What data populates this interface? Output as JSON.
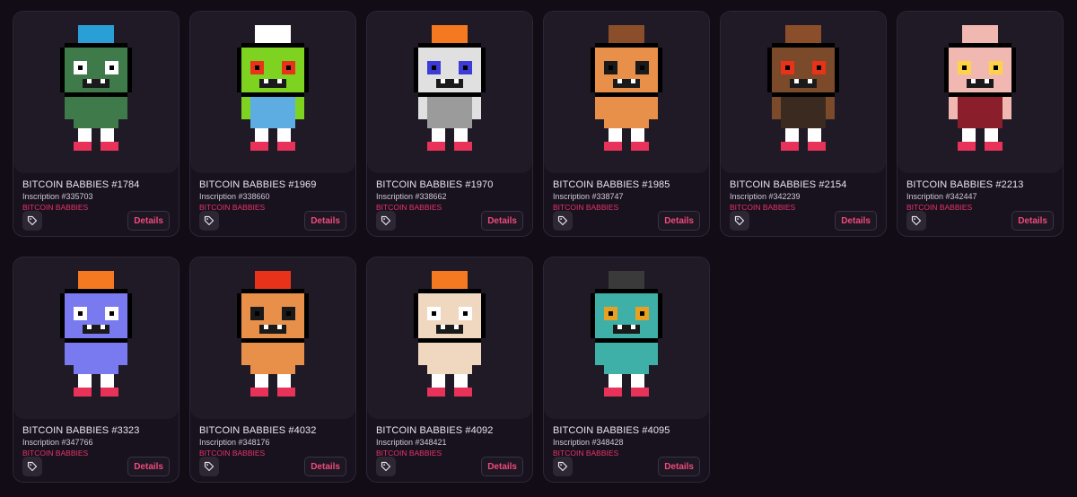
{
  "collection_label": "BITCOIN BABBIES",
  "details_label": "Details",
  "items": [
    {
      "name": "BITCOIN BABBIES #1784",
      "inscription": "Inscription #335703",
      "skin": "#3f7a4a",
      "hat": "#2a9fd6",
      "eyes": "#ffffff",
      "top": "#3f7a4a"
    },
    {
      "name": "BITCOIN BABBIES #1969",
      "inscription": "Inscription #338660",
      "skin": "#7ed321",
      "hat": "#ffffff",
      "eyes": "#e8321a",
      "top": "#5dade2"
    },
    {
      "name": "BITCOIN BABBIES #1970",
      "inscription": "Inscription #338662",
      "skin": "#e0e0e0",
      "hat": "#f47920",
      "eyes": "#3b3bd6",
      "top": "#9b9b9b"
    },
    {
      "name": "BITCOIN BABBIES #1985",
      "inscription": "Inscription #338747",
      "skin": "#e8904a",
      "hat": "#8a4e2a",
      "eyes": "#1a1a1a",
      "top": "#e8904a"
    },
    {
      "name": "BITCOIN BABBIES #2154",
      "inscription": "Inscription #342239",
      "skin": "#7a4a2a",
      "hat": "#8a4e2a",
      "eyes": "#e8321a",
      "top": "#3a2a20"
    },
    {
      "name": "BITCOIN BABBIES #2213",
      "inscription": "Inscription #342447",
      "skin": "#f0b8b0",
      "hat": "#f0b8b0",
      "eyes": "#ffd24a",
      "top": "#8a1e2a"
    },
    {
      "name": "BITCOIN BABBIES #3323",
      "inscription": "Inscription #347766",
      "skin": "#7a7af0",
      "hat": "#f47920",
      "eyes": "#ffffff",
      "top": "#7a7af0"
    },
    {
      "name": "BITCOIN BABBIES #4032",
      "inscription": "Inscription #348176",
      "skin": "#e8904a",
      "hat": "#e8321a",
      "eyes": "#1a1a1a",
      "top": "#e8904a"
    },
    {
      "name": "BITCOIN BABBIES #4092",
      "inscription": "Inscription #348421",
      "skin": "#f0d8c0",
      "hat": "#f47920",
      "eyes": "#ffffff",
      "top": "#f0d8c0"
    },
    {
      "name": "BITCOIN BABBIES #4095",
      "inscription": "Inscription #348428",
      "skin": "#3fb0a8",
      "hat": "#3a3a3a",
      "eyes": "#e8a020",
      "top": "#3fb0a8"
    }
  ]
}
